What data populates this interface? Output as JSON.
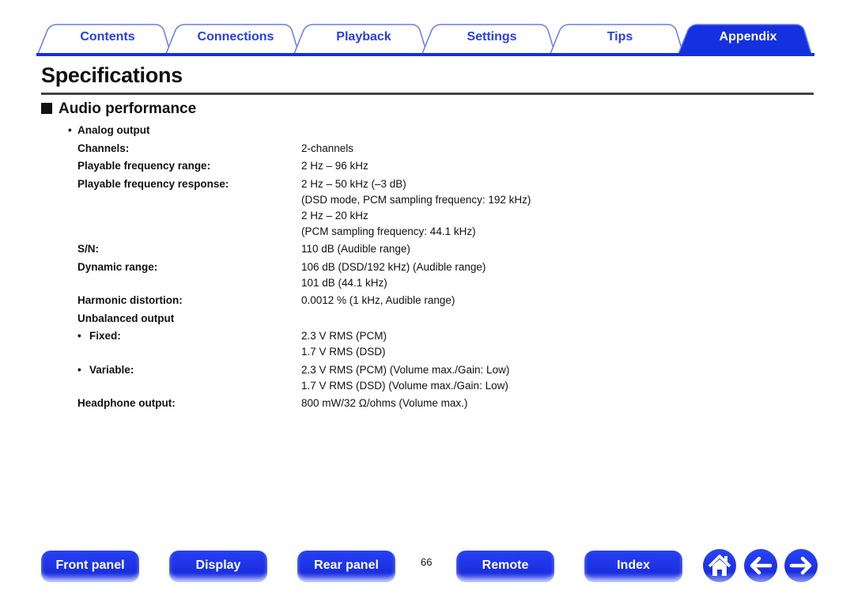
{
  "tabs": [
    {
      "label": "Contents"
    },
    {
      "label": "Connections"
    },
    {
      "label": "Playback"
    },
    {
      "label": "Settings"
    },
    {
      "label": "Tips"
    },
    {
      "label": "Appendix",
      "active": true
    }
  ],
  "page_title": "Specifications",
  "section_title": "Audio performance",
  "rows": [
    {
      "label": "Analog output",
      "bullet": 1,
      "values": []
    },
    {
      "label": "Channels:",
      "values": [
        "2-channels"
      ]
    },
    {
      "label": "Playable frequency range:",
      "values": [
        "2 Hz – 96 kHz"
      ]
    },
    {
      "label": "Playable frequency response:",
      "values": [
        "2 Hz – 50 kHz (–3 dB)",
        "(DSD mode, PCM sampling frequency: 192 kHz)",
        "2 Hz – 20 kHz",
        "(PCM sampling frequency: 44.1 kHz)"
      ]
    },
    {
      "label": "S/N:",
      "values": [
        "110 dB (Audible range)"
      ]
    },
    {
      "label": "Dynamic range:",
      "values": [
        "106 dB (DSD/192 kHz) (Audible range)",
        "101 dB (44.1 kHz)"
      ]
    },
    {
      "label": "Harmonic distortion:",
      "values": [
        "0.0012 % (1 kHz, Audible range)"
      ]
    },
    {
      "label": "Unbalanced output",
      "values": []
    },
    {
      "label": "Fixed:",
      "bullet": 2,
      "values": [
        "2.3 V RMS (PCM)",
        "1.7 V RMS (DSD)"
      ]
    },
    {
      "label": "Variable:",
      "bullet": 2,
      "values": [
        "2.3 V RMS (PCM) (Volume max./Gain: Low)",
        "1.7 V RMS (DSD) (Volume max./Gain: Low)"
      ]
    },
    {
      "label": "Headphone output:",
      "values": [
        "800 mW/32 Ω/ohms (Volume max.)"
      ]
    }
  ],
  "footer": {
    "buttons": [
      "Front panel",
      "Display",
      "Rear panel",
      "Remote",
      "Index"
    ],
    "page_number": "66",
    "icons": [
      "home-icon",
      "back-arrow-icon",
      "forward-arrow-icon"
    ]
  },
  "colors": {
    "accent": "#1530e0",
    "tab_text": "#2a3ee8"
  }
}
